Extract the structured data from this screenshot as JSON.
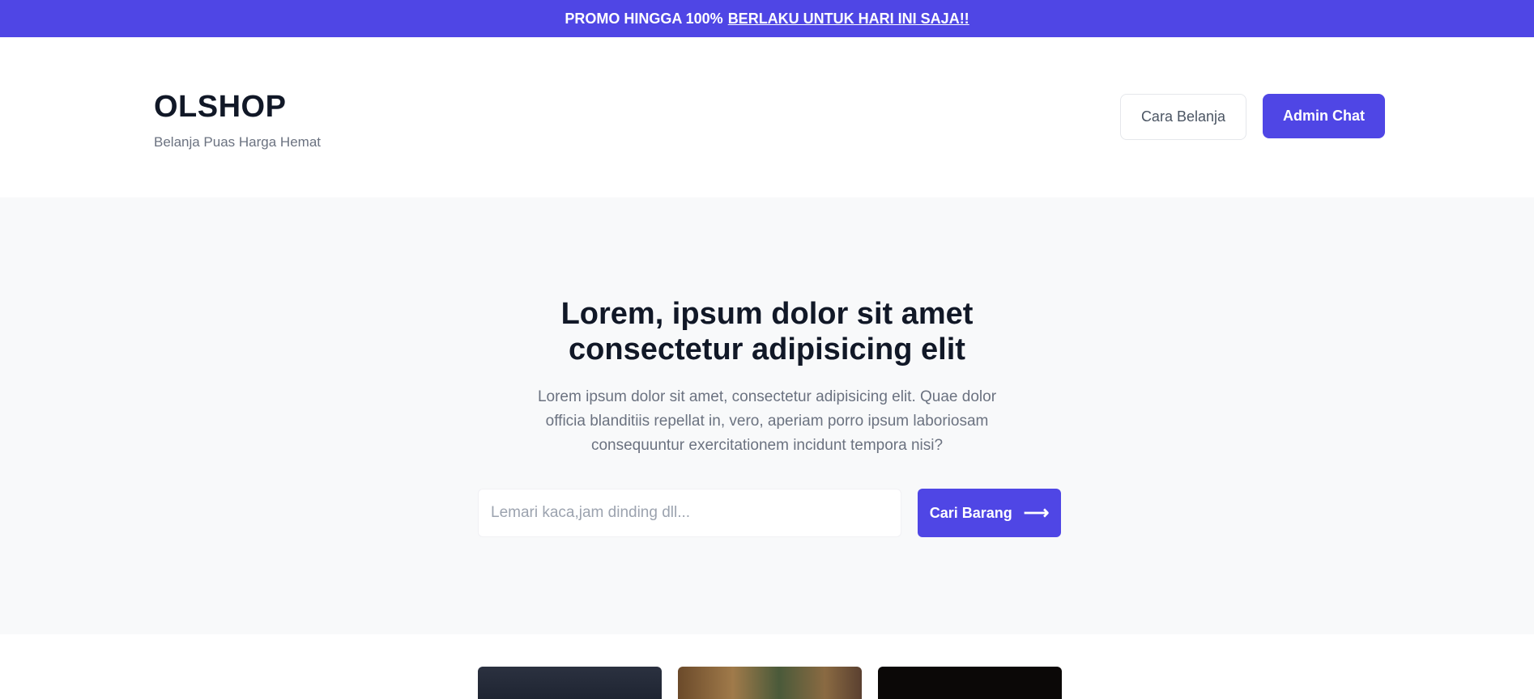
{
  "promo": {
    "text": "PROMO HINGGA 100%",
    "link": "BERLAKU UNTUK HARI INI SAJA!!"
  },
  "header": {
    "brand": "OLSHOP",
    "tagline": "Belanja Puas Harga Hemat",
    "nav_howto": "Cara Belanja",
    "nav_admin": "Admin Chat"
  },
  "hero": {
    "title": "Lorem, ipsum dolor sit amet consectetur adipisicing elit",
    "description": "Lorem ipsum dolor sit amet, consectetur adipisicing elit. Quae dolor officia blanditiis repellat in, vero, aperiam porro ipsum laboriosam consequuntur exercitationem incidunt tempora nisi?",
    "search_placeholder": "Lemari kaca,jam dinding dll...",
    "search_button": "Cari Barang",
    "search_icon": "arrow-right-icon"
  },
  "colors": {
    "primary": "#4f46e5",
    "hero_bg": "#f8f9fa"
  }
}
